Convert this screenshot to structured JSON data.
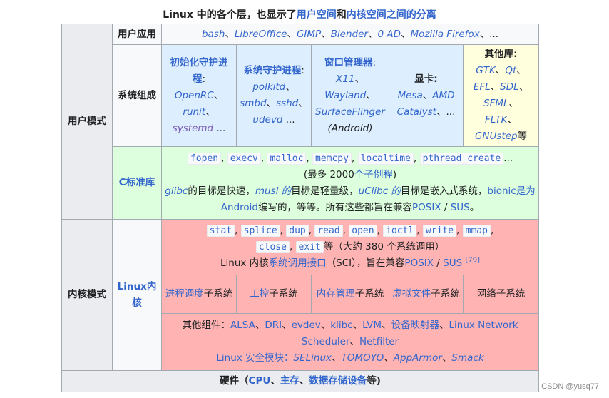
{
  "caption": {
    "prefix": "Linux 中的各个层，也显示了",
    "link1": "用户空间",
    "mid": "和",
    "link2": "内核空间之间的分离"
  },
  "user_mode": {
    "label": "用户模式",
    "apps": {
      "label": "用户应用",
      "items": [
        "bash",
        "LibreOffice",
        "GIMP",
        "Blender",
        "0 AD",
        "Mozilla Firefox"
      ],
      "sep": "、",
      "trailing": "、..."
    },
    "components": {
      "label": "系统组成",
      "init": {
        "title": "初始化守护进程",
        "colon": ":",
        "items": [
          "OpenRC",
          "runit",
          "systemd"
        ],
        "trailing": " ..."
      },
      "daemons": {
        "title": "系统守护进程",
        "colon": ":",
        "items": [
          "polkitd",
          "smbd",
          "sshd",
          "udevd"
        ],
        "trailing": " ..."
      },
      "window": {
        "title": "窗口管理器",
        "colon": ":",
        "items": [
          "X11",
          "Wayland",
          "SurfaceFlinger"
        ],
        "note": "(Android)"
      },
      "graphics": {
        "title": "显卡",
        "colon": ":",
        "items": [
          "Mesa",
          "AMD Catalyst"
        ],
        "trailing": "、..."
      },
      "other_libs": {
        "title": "其他库",
        "colon": ":",
        "items": [
          "GTK",
          "Qt",
          "EFL",
          "SDL",
          "SFML",
          "FLTK",
          "GNUstep"
        ],
        "trailing": "等"
      }
    },
    "clib": {
      "label": "C标准库",
      "functions": [
        "fopen",
        "execv",
        "malloc",
        "memcpy",
        "localtime",
        "pthread_create"
      ],
      "functions_trailing": "...",
      "count_prefix": "(最多 2000",
      "count_link": "个子例程",
      "count_suffix": ")",
      "desc": {
        "glibc": "glibc",
        "t1": "的目标是快速，",
        "musl": "musl 的",
        "t2": "目标是轻量级，",
        "uclibc": "uClibc 的",
        "t3": "目标是嵌入式系统，",
        "bionic": "bionic是为Android",
        "t4": "编写的，等等。所有这些都旨在兼容",
        "posix": "POSIX",
        "slash": " / ",
        "sus": "SUS",
        "end": "。"
      }
    }
  },
  "kernel_mode": {
    "label": "内核模式",
    "kernel_label": "Linux内核",
    "syscalls": [
      "stat",
      "splice",
      "dup",
      "read",
      "open",
      "ioctl",
      "write",
      "mmap",
      "close",
      "exit"
    ],
    "syscalls_suffix": "等（大约 380 个系统调用）",
    "sci_prefix": "Linux 内核",
    "sci_link": "系统调用接口",
    "sci_mid": "（SCI），旨在兼容",
    "posix": "POSIX",
    "slash": " / ",
    "sus": "SUS",
    "ref": "[79]",
    "subsystems": [
      {
        "link": "进程调度",
        "text": "子系统"
      },
      {
        "link": "工控",
        "text": "子系统"
      },
      {
        "link": "内存管理",
        "text": "子系统"
      },
      {
        "link": "虚拟文件",
        "text": "子系统"
      },
      {
        "link": "",
        "text": "网络子系统"
      }
    ],
    "other_components_label": "其他组件：",
    "other_components": [
      "ALSA",
      "DRI",
      "evdev",
      "klibc",
      "LVM",
      "设备映射器",
      "Linux Network Scheduler",
      "Netfilter"
    ],
    "security_label": "Linux 安全模块：",
    "security_modules": [
      "SELinux",
      "TOMOYO",
      "AppArmor",
      "Smack"
    ]
  },
  "hardware": {
    "prefix": "硬件（",
    "items": [
      "CPU",
      "主存",
      "数据存储设备"
    ],
    "suffix": "等)"
  },
  "watermark": "CSDN @yusq77"
}
